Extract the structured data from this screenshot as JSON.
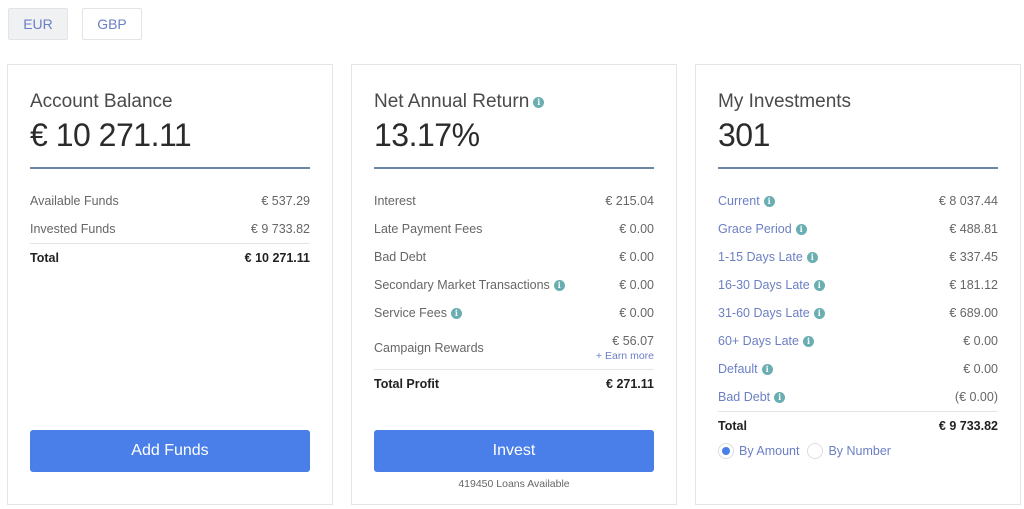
{
  "currency": {
    "options": [
      "EUR",
      "GBP"
    ],
    "selected": "EUR"
  },
  "account_balance": {
    "title": "Account Balance",
    "amount": "€ 10 271.11",
    "rows": [
      {
        "label": "Available Funds",
        "value": "€ 537.29"
      },
      {
        "label": "Invested Funds",
        "value": "€ 9 733.82"
      }
    ],
    "total": {
      "label": "Total",
      "value": "€ 10 271.11"
    },
    "button_label": "Add Funds"
  },
  "net_annual_return": {
    "title": "Net Annual Return",
    "amount": "13.17%",
    "rows": [
      {
        "label": "Interest",
        "value": "€ 215.04"
      },
      {
        "label": "Late Payment Fees",
        "value": "€ 0.00"
      },
      {
        "label": "Bad Debt",
        "value": "€ 0.00"
      },
      {
        "label": "Secondary Market Transactions",
        "value": "€ 0.00"
      },
      {
        "label": "Service Fees",
        "value": "€ 0.00"
      },
      {
        "label": "Campaign Rewards",
        "value": "€ 56.07",
        "link": "+ Earn more"
      }
    ],
    "total": {
      "label": "Total Profit",
      "value": "€ 271.11"
    },
    "button_label": "Invest",
    "loans_available": "419450 Loans Available"
  },
  "my_investments": {
    "title": "My Investments",
    "amount": "301",
    "rows": [
      {
        "label": "Current",
        "value": "€ 8 037.44"
      },
      {
        "label": "Grace Period",
        "value": "€ 488.81"
      },
      {
        "label": "1-15 Days Late",
        "value": "€ 337.45"
      },
      {
        "label": "16-30 Days Late",
        "value": "€ 181.12"
      },
      {
        "label": "31-60 Days Late",
        "value": "€ 689.00"
      },
      {
        "label": "60+ Days Late",
        "value": "€ 0.00"
      },
      {
        "label": "Default",
        "value": "€ 0.00"
      },
      {
        "label": "Bad Debt",
        "value": "(€ 0.00)"
      }
    ],
    "total": {
      "label": "Total",
      "value": "€ 9 733.82"
    },
    "view_options": [
      {
        "label": "By Amount",
        "checked": true
      },
      {
        "label": "By Number",
        "checked": false
      }
    ]
  },
  "icons": {
    "info": "i"
  },
  "colors": {
    "accent": "#4a7fea",
    "link": "#6b7fc4",
    "info": "#6aaeb2",
    "rule": "#6b86a8"
  }
}
